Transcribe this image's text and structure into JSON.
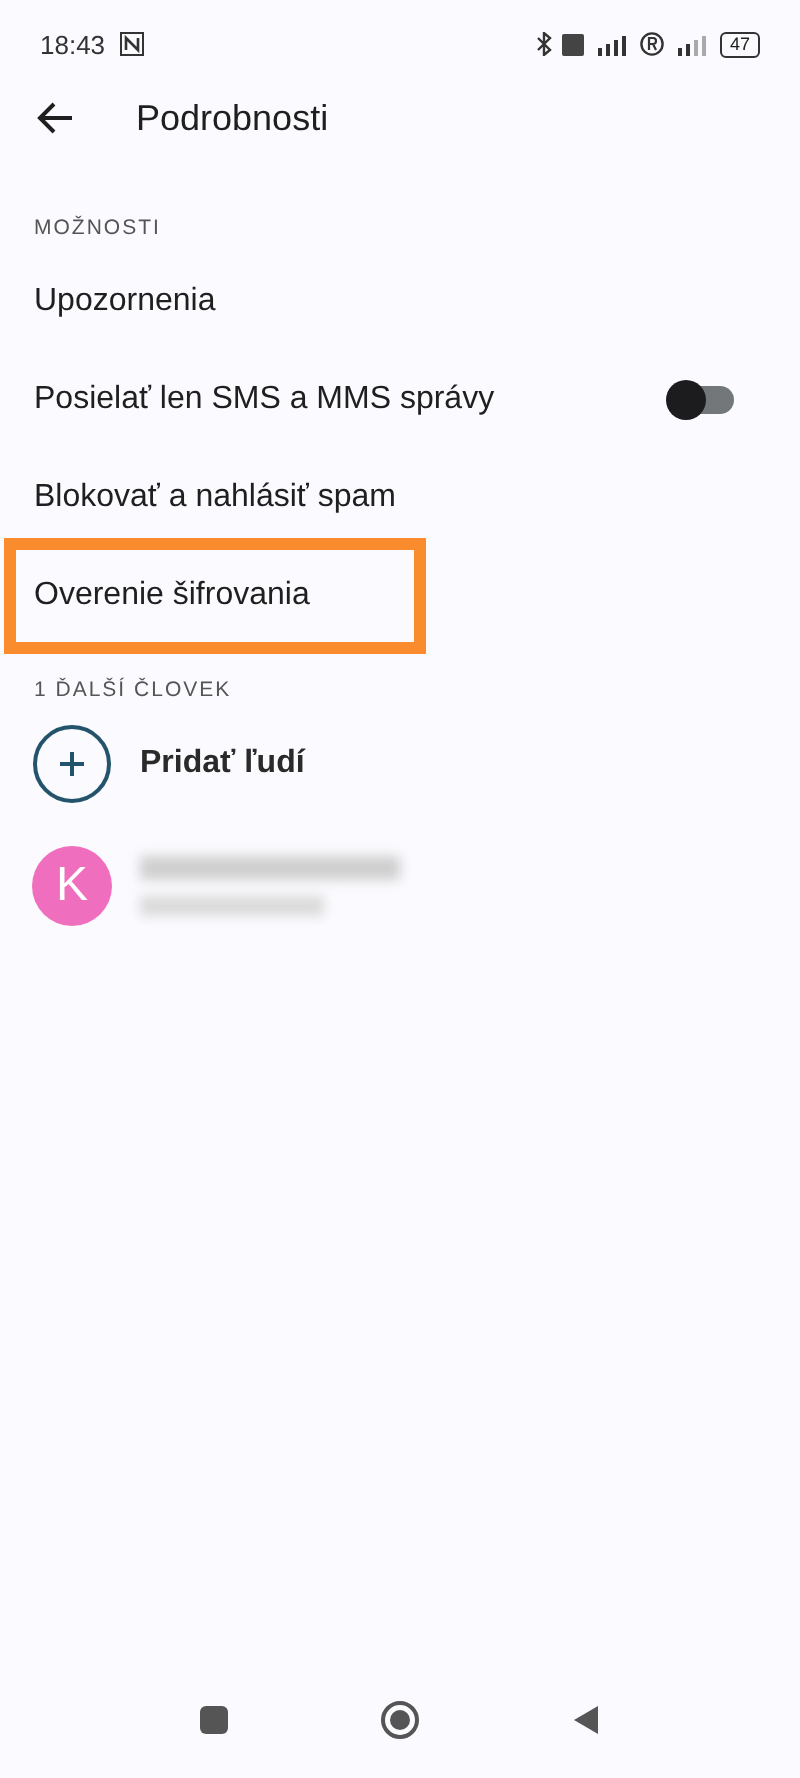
{
  "status_bar": {
    "time": "18:43",
    "battery": "47"
  },
  "header": {
    "title": "Podrobnosti"
  },
  "options": {
    "heading": "MOŽNOSTI",
    "items": [
      {
        "kind": "plain",
        "label": "Upozornenia",
        "highlighted": false
      },
      {
        "kind": "switch",
        "label": "Posielať len SMS a MMS správy",
        "on": false,
        "highlighted": false
      },
      {
        "kind": "plain",
        "label": "Blokovať a nahlásiť spam",
        "highlighted": false
      },
      {
        "kind": "plain",
        "label": "Overenie šifrovania",
        "highlighted": true
      }
    ]
  },
  "people": {
    "heading": "1 ĎALŠÍ ČLOVEK",
    "add_label": "Pridať ľudí",
    "contacts": [
      {
        "initial": "K",
        "color": "#f06ebe"
      }
    ]
  }
}
